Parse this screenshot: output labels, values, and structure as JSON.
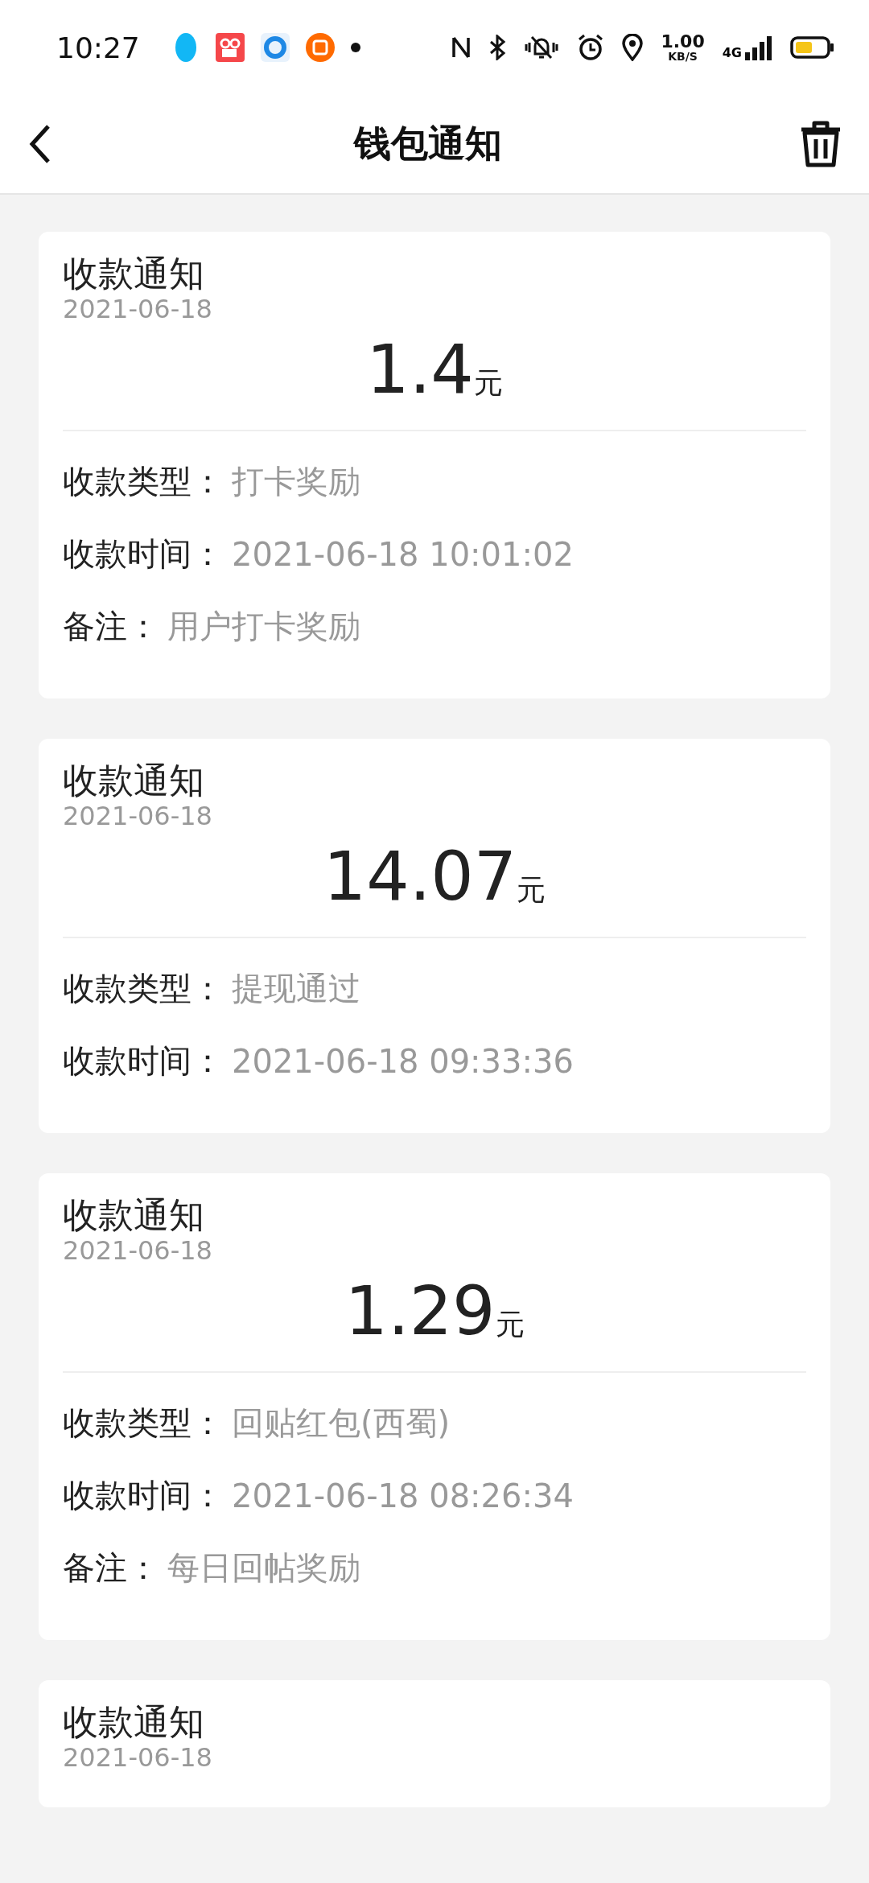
{
  "status_bar": {
    "time": "10:27",
    "net_speed": "1.00",
    "net_unit": "KB/S",
    "network": "4G"
  },
  "header": {
    "title": "钱包通知"
  },
  "notices": [
    {
      "title": "收款通知",
      "date": "2021-06-18",
      "amount": "1.4",
      "unit": "元",
      "fields": [
        {
          "label": "收款类型：",
          "value": "打卡奖励"
        },
        {
          "label": "收款时间：",
          "value": "2021-06-18 10:01:02"
        },
        {
          "label": "备注：",
          "value": "用户打卡奖励"
        }
      ]
    },
    {
      "title": "收款通知",
      "date": "2021-06-18",
      "amount": "14.07",
      "unit": "元",
      "fields": [
        {
          "label": "收款类型：",
          "value": "提现通过"
        },
        {
          "label": "收款时间：",
          "value": "2021-06-18 09:33:36"
        }
      ]
    },
    {
      "title": "收款通知",
      "date": "2021-06-18",
      "amount": "1.29",
      "unit": "元",
      "fields": [
        {
          "label": "收款类型：",
          "value": "回贴红包(西蜀)"
        },
        {
          "label": "收款时间：",
          "value": "2021-06-18 08:26:34"
        },
        {
          "label": "备注：",
          "value": "每日回帖奖励"
        }
      ]
    },
    {
      "title": "收款通知",
      "date": "2021-06-18"
    }
  ]
}
